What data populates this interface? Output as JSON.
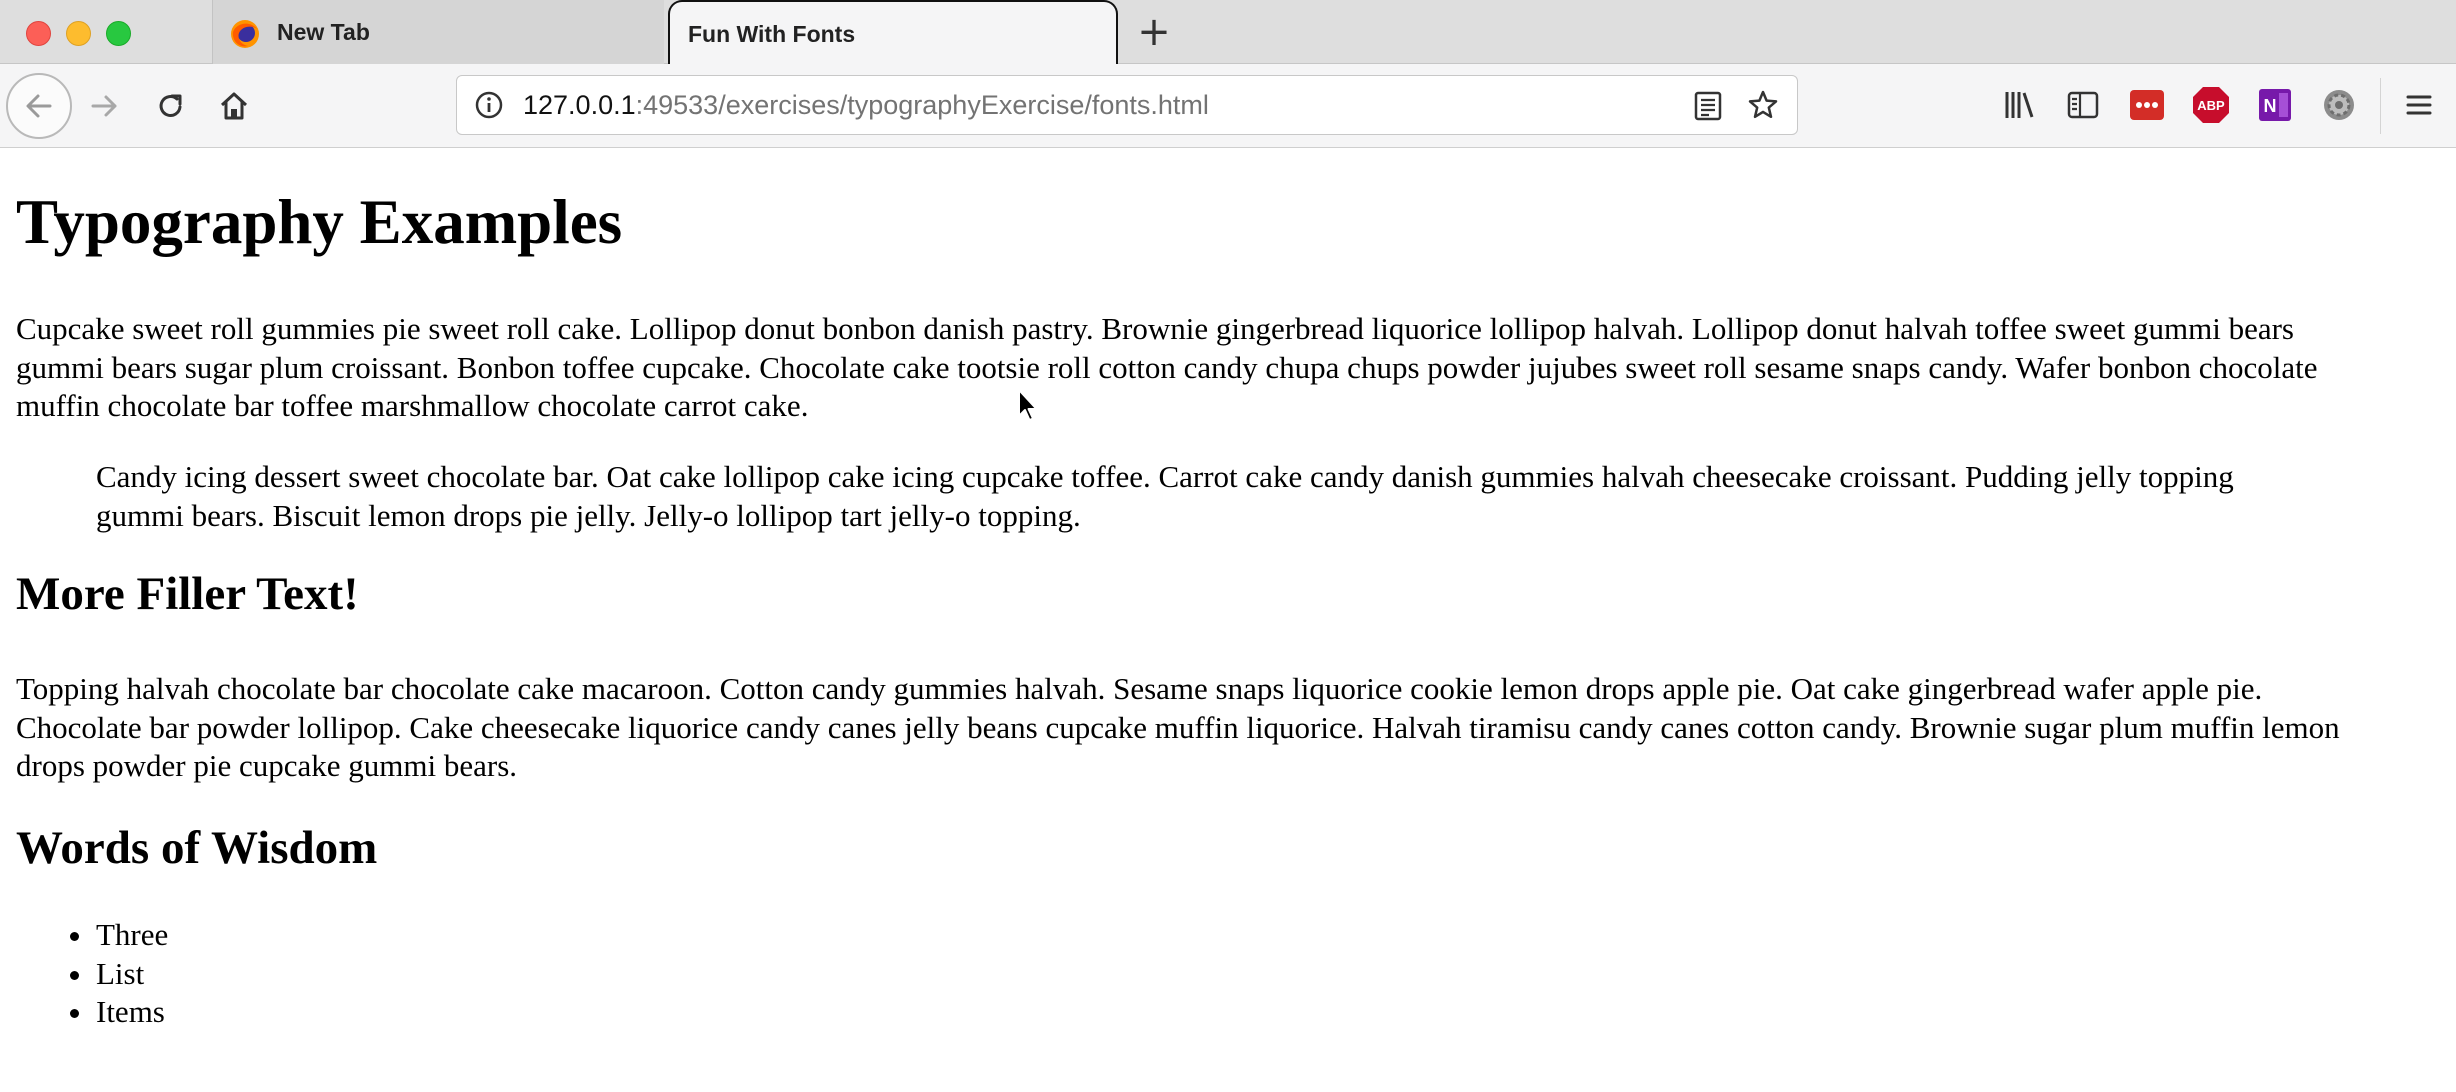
{
  "browser": {
    "tabs": [
      {
        "label": "New Tab",
        "active": false,
        "icon": "firefox-icon"
      },
      {
        "label": "Fun With Fonts",
        "active": true
      }
    ],
    "new_tab_label": "+",
    "url": {
      "host": "127.0.0.1",
      "rest": ":49533/exercises/typographyExercise/fonts.html"
    },
    "toolbar_icons": [
      "library-icon",
      "sidebar-icon",
      "lastpass-icon",
      "adblock-plus-icon",
      "onenote-icon",
      "settings-gear-icon",
      "menu-icon"
    ],
    "adblock_label": "ABP",
    "onenote_label": "N"
  },
  "page": {
    "title": "Typography Examples",
    "paragraph1": [
      "Cupcake sweet roll gummies pie sweet roll cake. Lollipop donut bonbon danish pastry. Brownie gingerbread liquorice lollipop halvah. Lollipop donut halvah toffee sweet gummi bears",
      "gummi bears sugar plum croissant. Bonbon toffee cupcake. Chocolate cake tootsie roll cotton candy chupa chups powder jujubes sweet roll sesame snaps candy. Wafer bonbon chocolate",
      "muffin chocolate bar toffee marshmallow chocolate carrot cake."
    ],
    "blockquote": [
      "Candy icing dessert sweet chocolate bar. Oat cake lollipop cake icing cupcake toffee. Carrot cake candy danish gummies halvah cheesecake croissant. Pudding jelly topping",
      "gummi bears. Biscuit lemon drops pie jelly. Jelly-o lollipop tart jelly-o topping."
    ],
    "heading2": "More Filler Text!",
    "paragraph2": [
      "Topping halvah chocolate bar chocolate cake macaroon. Cotton candy gummies halvah. Sesame snaps liquorice cookie lemon drops apple pie. Oat cake gingerbread wafer apple pie.",
      "Chocolate bar powder lollipop. Cake cheesecake liquorice candy canes jelly beans cupcake muffin liquorice. Halvah tiramisu candy canes cotton candy. Brownie sugar plum muffin lemon",
      "drops powder pie cupcake gummi bears."
    ],
    "heading3": "Words of Wisdom",
    "list_items": [
      "Three",
      "List",
      "Items"
    ]
  },
  "colors": {
    "tab_bar": "#dedede",
    "active_tab": "#f5f5f6",
    "url_text": "#737373",
    "lastpass": "#d32d27",
    "adblock": "#c70d2c",
    "onenote": "#7719aa"
  }
}
